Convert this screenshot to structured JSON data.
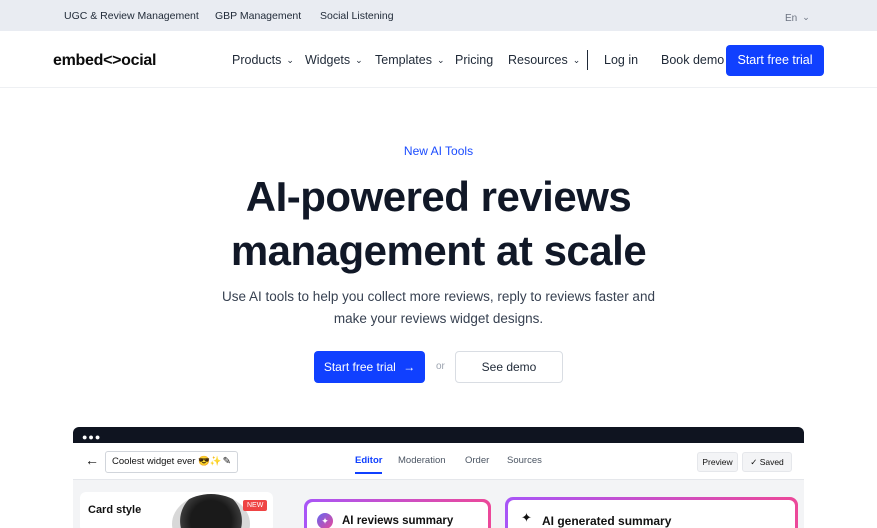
{
  "topbar": {
    "links": [
      "UGC & Review Management",
      "GBP Management",
      "Social Listening"
    ],
    "lang": "En"
  },
  "nav": {
    "logo": "embed<>ocial",
    "products": "Products",
    "widgets": "Widgets",
    "templates": "Templates",
    "pricing": "Pricing",
    "resources": "Resources",
    "login": "Log in",
    "book_demo": "Book demo",
    "start_trial": "Start free trial"
  },
  "hero": {
    "eyebrow": "New AI Tools",
    "title_line1": "AI-powered reviews",
    "title_line2": "management at scale",
    "subtitle_line1": "Use AI tools to help you collect more reviews, reply to reviews faster and",
    "subtitle_line2": "make your reviews widget designs.",
    "cta_primary": "Start free trial",
    "or": "or",
    "cta_secondary": "See demo"
  },
  "mockup": {
    "widget_name": "Coolest widget ever 😎✨",
    "tabs": [
      "Editor",
      "Moderation",
      "Order",
      "Sources"
    ],
    "preview": "Preview",
    "saved": "Saved",
    "card_style": "Card style",
    "new_badge": "NEW",
    "ai_reviews_summary": "AI reviews summary",
    "ai_generated_summary": "AI generated summary"
  },
  "colors": {
    "accent": "#1040ff",
    "topbar_bg": "#e9ecf2",
    "gradient_start": "#a855f7",
    "gradient_end": "#ec4899"
  }
}
